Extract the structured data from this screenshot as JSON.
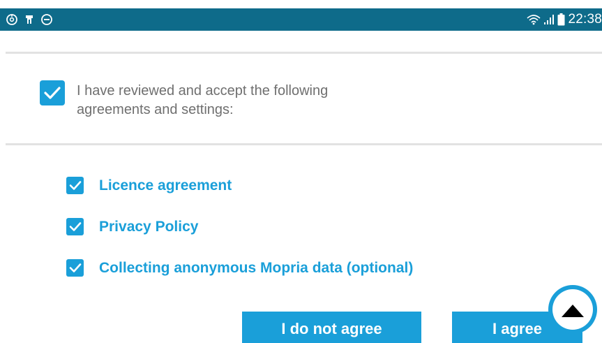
{
  "status_bar": {
    "time": "22:38",
    "left_icons": [
      "sync-icon",
      "tooth-icon",
      "do-not-disturb-icon"
    ],
    "right_icons": [
      "wifi-icon",
      "signal-icon",
      "battery-icon"
    ],
    "background_color": "#0e6b8a"
  },
  "consent": {
    "master_checked": true,
    "master_text": "I have reviewed and accept the following agreements and settings:"
  },
  "agreements": [
    {
      "label": "Licence agreement",
      "checked": true
    },
    {
      "label": "Privacy Policy",
      "checked": true
    },
    {
      "label": "Collecting anonymous Mopria data (optional)",
      "checked": true
    }
  ],
  "buttons": {
    "decline_label": "I do not agree",
    "accept_label": "I agree"
  },
  "fab": {
    "icon": "arrow-up-icon"
  },
  "colors": {
    "accent": "#1a9fd9",
    "master_text": "#6f6f6f",
    "divider": "#e2e2e2"
  }
}
